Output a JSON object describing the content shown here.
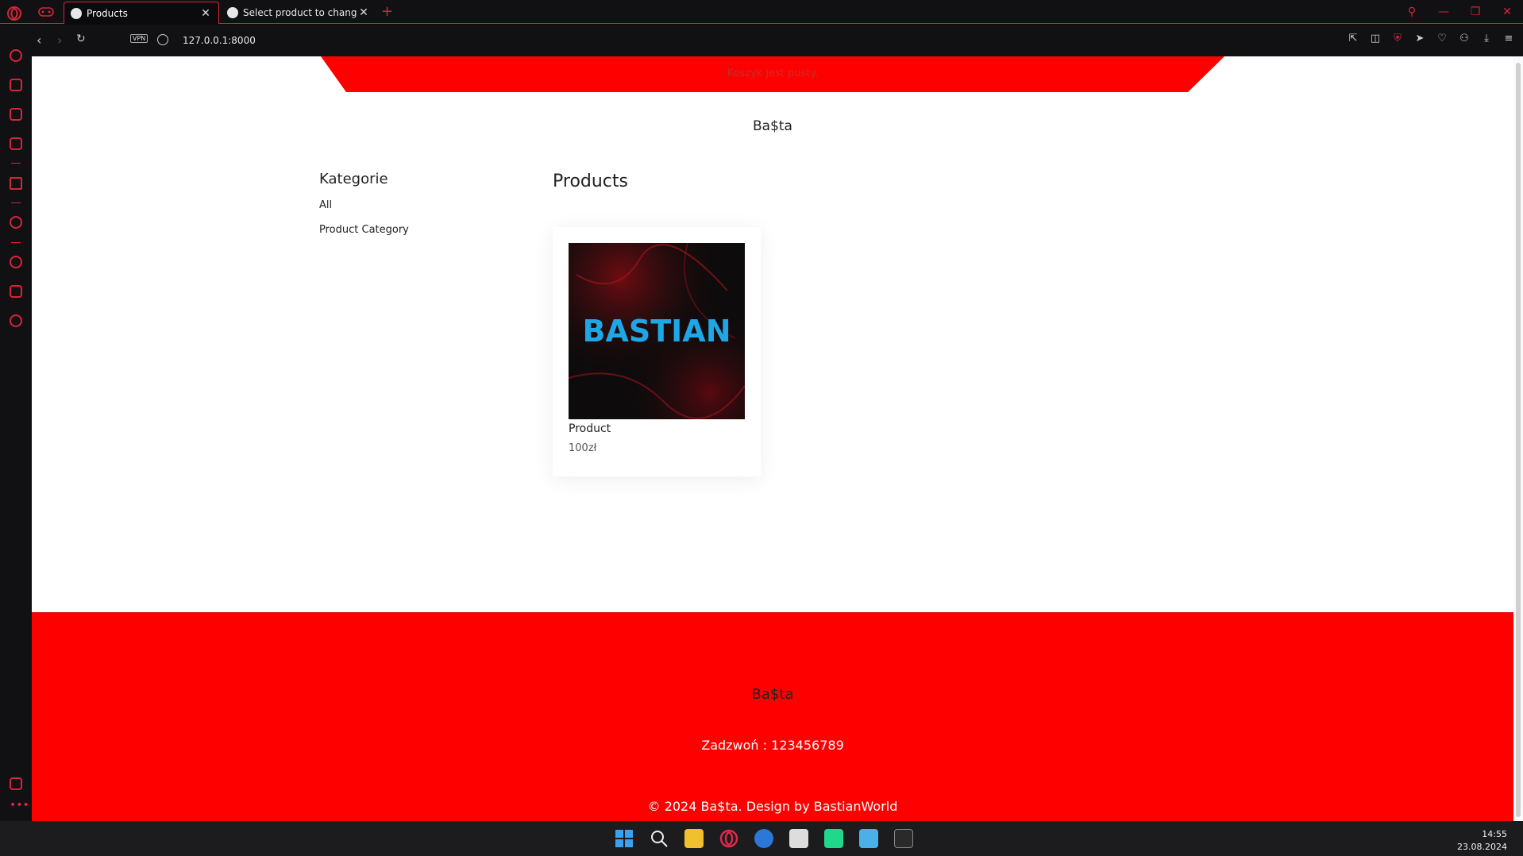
{
  "browser": {
    "tabs": [
      {
        "label": "Products",
        "active": true
      },
      {
        "label": "Select product to change |",
        "active": false
      }
    ],
    "new_tab": "+",
    "url": "127.0.0.1:8000",
    "vpn_label": "VPN",
    "accent": "#d8243a"
  },
  "page": {
    "cart_status": "Koszyk jest pusty.",
    "brand": "Ba$ta",
    "categories_title": "Kategorie",
    "categories": [
      "All",
      "Product Category"
    ],
    "products_heading": "Products",
    "products": [
      {
        "name": "Product",
        "price": "100zł",
        "image_text": "BASTIAN"
      }
    ],
    "footer": {
      "brand": "Ba$ta",
      "phone": "Zadzwoń : 123456789",
      "copyright": "© 2024 Ba$ta. Design by BastianWorld"
    },
    "colors": {
      "primary_red": "#ff0000",
      "logo_blue": "#1ea7e6"
    }
  },
  "taskbar": {
    "time": "14:55",
    "date": "23.08.2024"
  }
}
